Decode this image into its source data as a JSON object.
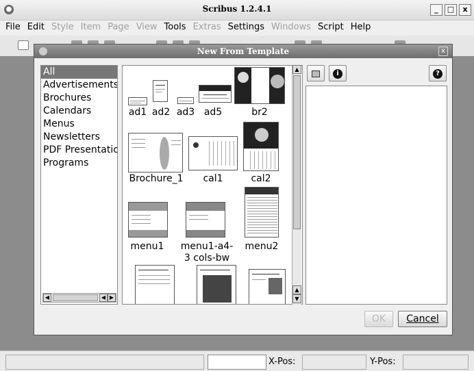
{
  "window": {
    "title": "Scribus 1.2.4.1"
  },
  "menu": [
    {
      "label": "File",
      "enabled": true
    },
    {
      "label": "Edit",
      "enabled": true
    },
    {
      "label": "Style",
      "enabled": false
    },
    {
      "label": "Item",
      "enabled": false
    },
    {
      "label": "Page",
      "enabled": false
    },
    {
      "label": "View",
      "enabled": false
    },
    {
      "label": "Tools",
      "enabled": true
    },
    {
      "label": "Extras",
      "enabled": false
    },
    {
      "label": "Settings",
      "enabled": true
    },
    {
      "label": "Windows",
      "enabled": false
    },
    {
      "label": "Script",
      "enabled": true
    },
    {
      "label": "Help",
      "enabled": true
    }
  ],
  "dialog": {
    "title": "New From Template",
    "categories": [
      "All",
      "Advertisements",
      "Brochures",
      "Calendars",
      "Menus",
      "Newsletters",
      "PDF Presentatio",
      "Programs"
    ],
    "selected_category": "All",
    "templates": [
      {
        "name": "ad1"
      },
      {
        "name": "ad2"
      },
      {
        "name": "ad3"
      },
      {
        "name": "ad5"
      },
      {
        "name": "br2"
      },
      {
        "name": "Brochure_1"
      },
      {
        "name": "cal1"
      },
      {
        "name": "cal2"
      },
      {
        "name": "menu1"
      },
      {
        "name": "menu1-a4-3 cols-bw"
      },
      {
        "name": "menu2"
      }
    ],
    "ok_label": "OK",
    "cancel_label": "Cancel"
  },
  "status": {
    "xpos_label": "X-Pos:",
    "ypos_label": "Y-Pos:"
  }
}
